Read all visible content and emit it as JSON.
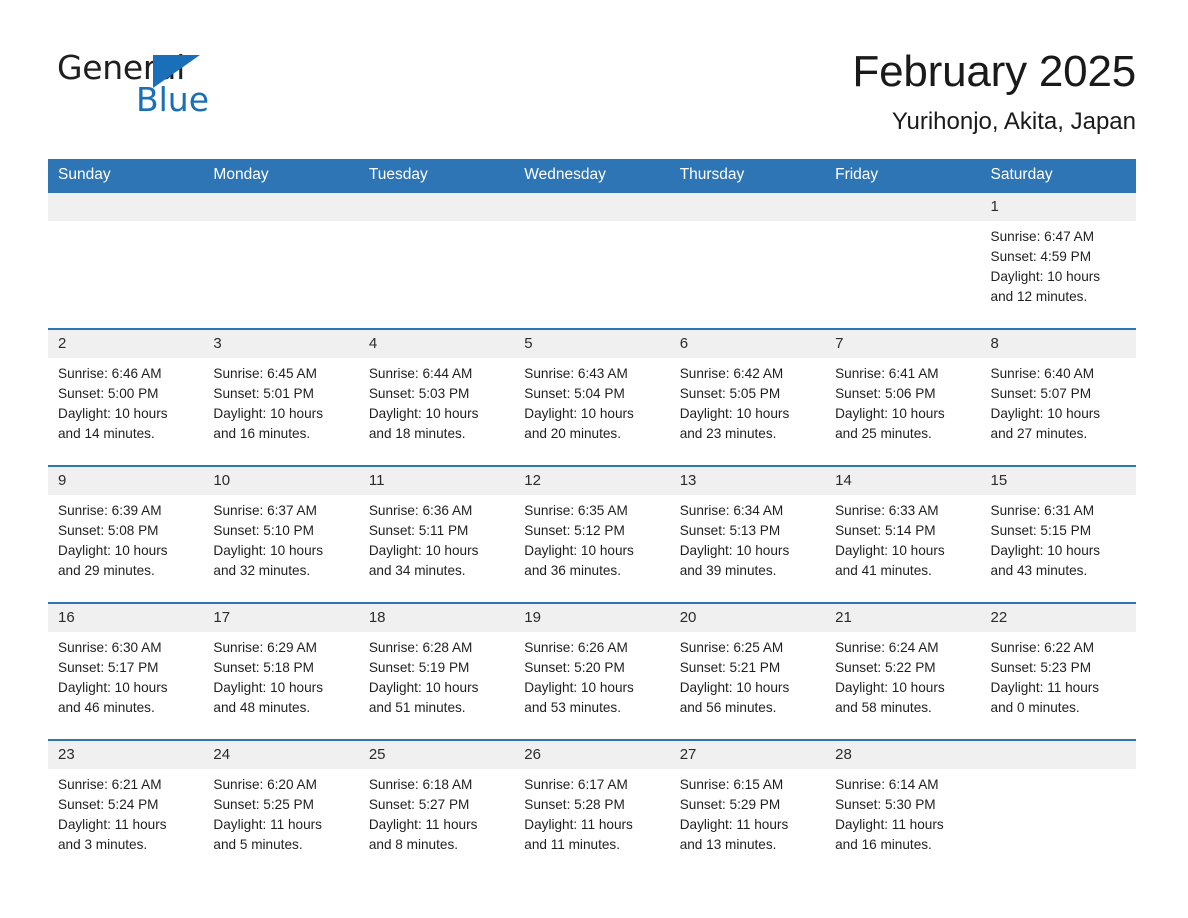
{
  "brand": {
    "name_part1": "General",
    "name_part2": "Blue"
  },
  "header": {
    "title": "February 2025",
    "location": "Yurihonjo, Akita, Japan"
  },
  "colors": {
    "header_blue": "#2e75b6",
    "brand_blue": "#1a70b8",
    "daynum_gray": "#f0f0f0"
  },
  "calendar": {
    "weekday_headers": [
      "Sunday",
      "Monday",
      "Tuesday",
      "Wednesday",
      "Thursday",
      "Friday",
      "Saturday"
    ],
    "weeks": [
      [
        {
          "day": "",
          "sunrise": "",
          "sunset": "",
          "daylight_line1": "",
          "daylight_line2": ""
        },
        {
          "day": "",
          "sunrise": "",
          "sunset": "",
          "daylight_line1": "",
          "daylight_line2": ""
        },
        {
          "day": "",
          "sunrise": "",
          "sunset": "",
          "daylight_line1": "",
          "daylight_line2": ""
        },
        {
          "day": "",
          "sunrise": "",
          "sunset": "",
          "daylight_line1": "",
          "daylight_line2": ""
        },
        {
          "day": "",
          "sunrise": "",
          "sunset": "",
          "daylight_line1": "",
          "daylight_line2": ""
        },
        {
          "day": "",
          "sunrise": "",
          "sunset": "",
          "daylight_line1": "",
          "daylight_line2": ""
        },
        {
          "day": "1",
          "sunrise": "Sunrise: 6:47 AM",
          "sunset": "Sunset: 4:59 PM",
          "daylight_line1": "Daylight: 10 hours",
          "daylight_line2": "and 12 minutes."
        }
      ],
      [
        {
          "day": "2",
          "sunrise": "Sunrise: 6:46 AM",
          "sunset": "Sunset: 5:00 PM",
          "daylight_line1": "Daylight: 10 hours",
          "daylight_line2": "and 14 minutes."
        },
        {
          "day": "3",
          "sunrise": "Sunrise: 6:45 AM",
          "sunset": "Sunset: 5:01 PM",
          "daylight_line1": "Daylight: 10 hours",
          "daylight_line2": "and 16 minutes."
        },
        {
          "day": "4",
          "sunrise": "Sunrise: 6:44 AM",
          "sunset": "Sunset: 5:03 PM",
          "daylight_line1": "Daylight: 10 hours",
          "daylight_line2": "and 18 minutes."
        },
        {
          "day": "5",
          "sunrise": "Sunrise: 6:43 AM",
          "sunset": "Sunset: 5:04 PM",
          "daylight_line1": "Daylight: 10 hours",
          "daylight_line2": "and 20 minutes."
        },
        {
          "day": "6",
          "sunrise": "Sunrise: 6:42 AM",
          "sunset": "Sunset: 5:05 PM",
          "daylight_line1": "Daylight: 10 hours",
          "daylight_line2": "and 23 minutes."
        },
        {
          "day": "7",
          "sunrise": "Sunrise: 6:41 AM",
          "sunset": "Sunset: 5:06 PM",
          "daylight_line1": "Daylight: 10 hours",
          "daylight_line2": "and 25 minutes."
        },
        {
          "day": "8",
          "sunrise": "Sunrise: 6:40 AM",
          "sunset": "Sunset: 5:07 PM",
          "daylight_line1": "Daylight: 10 hours",
          "daylight_line2": "and 27 minutes."
        }
      ],
      [
        {
          "day": "9",
          "sunrise": "Sunrise: 6:39 AM",
          "sunset": "Sunset: 5:08 PM",
          "daylight_line1": "Daylight: 10 hours",
          "daylight_line2": "and 29 minutes."
        },
        {
          "day": "10",
          "sunrise": "Sunrise: 6:37 AM",
          "sunset": "Sunset: 5:10 PM",
          "daylight_line1": "Daylight: 10 hours",
          "daylight_line2": "and 32 minutes."
        },
        {
          "day": "11",
          "sunrise": "Sunrise: 6:36 AM",
          "sunset": "Sunset: 5:11 PM",
          "daylight_line1": "Daylight: 10 hours",
          "daylight_line2": "and 34 minutes."
        },
        {
          "day": "12",
          "sunrise": "Sunrise: 6:35 AM",
          "sunset": "Sunset: 5:12 PM",
          "daylight_line1": "Daylight: 10 hours",
          "daylight_line2": "and 36 minutes."
        },
        {
          "day": "13",
          "sunrise": "Sunrise: 6:34 AM",
          "sunset": "Sunset: 5:13 PM",
          "daylight_line1": "Daylight: 10 hours",
          "daylight_line2": "and 39 minutes."
        },
        {
          "day": "14",
          "sunrise": "Sunrise: 6:33 AM",
          "sunset": "Sunset: 5:14 PM",
          "daylight_line1": "Daylight: 10 hours",
          "daylight_line2": "and 41 minutes."
        },
        {
          "day": "15",
          "sunrise": "Sunrise: 6:31 AM",
          "sunset": "Sunset: 5:15 PM",
          "daylight_line1": "Daylight: 10 hours",
          "daylight_line2": "and 43 minutes."
        }
      ],
      [
        {
          "day": "16",
          "sunrise": "Sunrise: 6:30 AM",
          "sunset": "Sunset: 5:17 PM",
          "daylight_line1": "Daylight: 10 hours",
          "daylight_line2": "and 46 minutes."
        },
        {
          "day": "17",
          "sunrise": "Sunrise: 6:29 AM",
          "sunset": "Sunset: 5:18 PM",
          "daylight_line1": "Daylight: 10 hours",
          "daylight_line2": "and 48 minutes."
        },
        {
          "day": "18",
          "sunrise": "Sunrise: 6:28 AM",
          "sunset": "Sunset: 5:19 PM",
          "daylight_line1": "Daylight: 10 hours",
          "daylight_line2": "and 51 minutes."
        },
        {
          "day": "19",
          "sunrise": "Sunrise: 6:26 AM",
          "sunset": "Sunset: 5:20 PM",
          "daylight_line1": "Daylight: 10 hours",
          "daylight_line2": "and 53 minutes."
        },
        {
          "day": "20",
          "sunrise": "Sunrise: 6:25 AM",
          "sunset": "Sunset: 5:21 PM",
          "daylight_line1": "Daylight: 10 hours",
          "daylight_line2": "and 56 minutes."
        },
        {
          "day": "21",
          "sunrise": "Sunrise: 6:24 AM",
          "sunset": "Sunset: 5:22 PM",
          "daylight_line1": "Daylight: 10 hours",
          "daylight_line2": "and 58 minutes."
        },
        {
          "day": "22",
          "sunrise": "Sunrise: 6:22 AM",
          "sunset": "Sunset: 5:23 PM",
          "daylight_line1": "Daylight: 11 hours",
          "daylight_line2": "and 0 minutes."
        }
      ],
      [
        {
          "day": "23",
          "sunrise": "Sunrise: 6:21 AM",
          "sunset": "Sunset: 5:24 PM",
          "daylight_line1": "Daylight: 11 hours",
          "daylight_line2": "and 3 minutes."
        },
        {
          "day": "24",
          "sunrise": "Sunrise: 6:20 AM",
          "sunset": "Sunset: 5:25 PM",
          "daylight_line1": "Daylight: 11 hours",
          "daylight_line2": "and 5 minutes."
        },
        {
          "day": "25",
          "sunrise": "Sunrise: 6:18 AM",
          "sunset": "Sunset: 5:27 PM",
          "daylight_line1": "Daylight: 11 hours",
          "daylight_line2": "and 8 minutes."
        },
        {
          "day": "26",
          "sunrise": "Sunrise: 6:17 AM",
          "sunset": "Sunset: 5:28 PM",
          "daylight_line1": "Daylight: 11 hours",
          "daylight_line2": "and 11 minutes."
        },
        {
          "day": "27",
          "sunrise": "Sunrise: 6:15 AM",
          "sunset": "Sunset: 5:29 PM",
          "daylight_line1": "Daylight: 11 hours",
          "daylight_line2": "and 13 minutes."
        },
        {
          "day": "28",
          "sunrise": "Sunrise: 6:14 AM",
          "sunset": "Sunset: 5:30 PM",
          "daylight_line1": "Daylight: 11 hours",
          "daylight_line2": "and 16 minutes."
        },
        {
          "day": "",
          "sunrise": "",
          "sunset": "",
          "daylight_line1": "",
          "daylight_line2": ""
        }
      ]
    ]
  }
}
